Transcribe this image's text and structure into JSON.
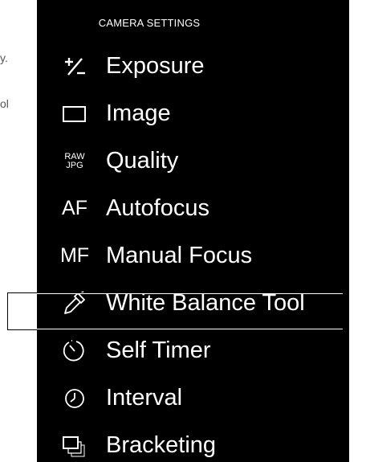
{
  "background": {
    "fragments": [
      "y.",
      "ol"
    ]
  },
  "panel": {
    "title": "CAMERA SETTINGS",
    "items": [
      {
        "label": "Exposure",
        "icon": "exposure-plus-minus-icon"
      },
      {
        "label": "Image",
        "icon": "image-frame-icon"
      },
      {
        "label": "Quality",
        "icon": "raw-jpg-icon",
        "icon_text_top": "RAW",
        "icon_text_bottom": "JPG"
      },
      {
        "label": "Autofocus",
        "icon": "af-icon",
        "icon_text": "AF"
      },
      {
        "label": "Manual Focus",
        "icon": "mf-icon",
        "icon_text": "MF"
      },
      {
        "label": "White Balance Tool",
        "icon": "eyedropper-icon",
        "selected": true
      },
      {
        "label": "Self Timer",
        "icon": "self-timer-icon"
      },
      {
        "label": "Interval",
        "icon": "clock-icon"
      },
      {
        "label": "Bracketing",
        "icon": "bracketing-icon"
      }
    ]
  },
  "colors": {
    "panel_bg": "#000000",
    "text": "#ffffff",
    "selection_border": "#000000"
  }
}
